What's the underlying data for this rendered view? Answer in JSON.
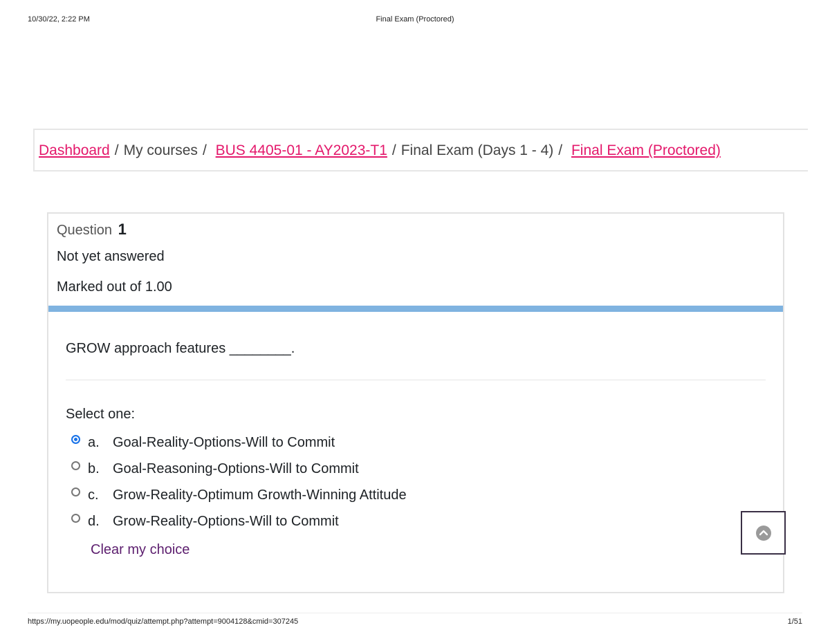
{
  "print_header": {
    "date": "10/30/22, 2:22 PM",
    "title": "Final Exam (Proctored)"
  },
  "breadcrumb": {
    "items": [
      {
        "label": "Dashboard",
        "link": true
      },
      {
        "label": "My courses",
        "link": false
      },
      {
        "label": "BUS 4405-01 - AY2023-T1",
        "link": true
      },
      {
        "label": "Final Exam (Days 1 - 4)",
        "link": false
      },
      {
        "label": "Final Exam (Proctored)",
        "link": true
      }
    ],
    "separator": "/"
  },
  "question": {
    "label": "Question",
    "number": "1",
    "state": "Not yet answered",
    "grade": "Marked out of 1.00",
    "text": "GROW approach features ________.",
    "prompt": "Select one:",
    "options": [
      {
        "letter": "a.",
        "text": "Goal-Reality-Options-Will to Commit",
        "selected": true
      },
      {
        "letter": "b.",
        "text": "Goal-Reasoning-Options-Will to Commit",
        "selected": false
      },
      {
        "letter": "c.",
        "text": "Grow-Reality-Optimum Growth-Winning Attitude",
        "selected": false
      },
      {
        "letter": "d.",
        "text": "Grow-Reality-Options-Will to Commit",
        "selected": false
      }
    ],
    "clear_label": "Clear my choice"
  },
  "print_footer": {
    "url": "https://my.uopeople.edu/mod/quiz/attempt.php?attempt=9004128&cmid=307245",
    "page": "1/51"
  },
  "colors": {
    "link": "#e4186b",
    "accent_bar": "#7fb3e0",
    "clear_link": "#5c1e6e",
    "radio_checked": "#1a73e8"
  },
  "icons": {
    "scroll_top": "chevron-up-icon"
  }
}
